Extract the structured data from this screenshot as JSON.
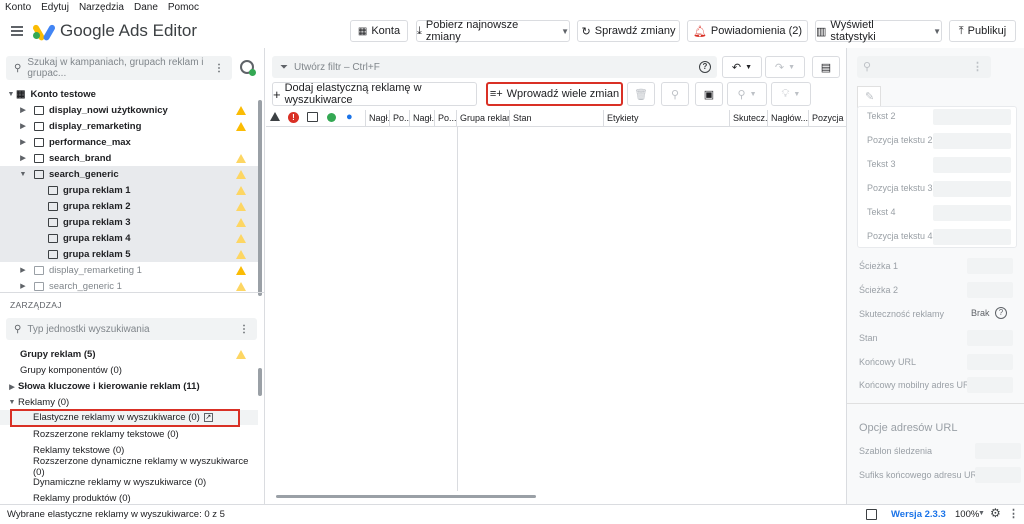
{
  "menu": [
    "Konto",
    "Edytuj",
    "Narzędzia",
    "Dane",
    "Pomoc"
  ],
  "app": {
    "name": "Google Ads Editor"
  },
  "header_buttons": {
    "accounts": "Konta",
    "get_changes": "Pobierz najnowsze zmiany",
    "check_changes": "Sprawdź zmiany",
    "notifications": "Powiadomienia (2)",
    "stats": "Wyświetl statystyki",
    "publish": "Publikuj"
  },
  "left": {
    "search_placeholder": "Szukaj w kampaniach, grupach reklam i grupac...",
    "tree": [
      {
        "label": "Konto testowe",
        "warn": ""
      },
      {
        "label": "display_nowi użytkownicy",
        "warn": "solid"
      },
      {
        "label": "display_remarketing",
        "warn": "solid"
      },
      {
        "label": "performance_max",
        "warn": ""
      },
      {
        "label": "search_brand",
        "warn": "outline"
      },
      {
        "label": "search_generic",
        "warn": "outline"
      },
      {
        "label": "grupa reklam 1",
        "warn": "outline"
      },
      {
        "label": "grupa reklam 2",
        "warn": "outline"
      },
      {
        "label": "grupa reklam 3",
        "warn": "outline"
      },
      {
        "label": "grupa reklam 4",
        "warn": "outline"
      },
      {
        "label": "grupa reklam 5",
        "warn": "outline"
      },
      {
        "label": "display_remarketing 1",
        "warn": "solid"
      },
      {
        "label": "search_generic 1",
        "warn": "outline"
      }
    ],
    "manage_label": "ZARZĄDZAJ",
    "manage_search_placeholder": "Typ jednostki wyszukiwania",
    "manage_items": [
      {
        "label": "Grupy reklam (5)",
        "warn": "outline"
      },
      {
        "label": "Grupy komponentów (0)",
        "warn": ""
      },
      {
        "label": "Słowa kluczowe i kierowanie reklam (11)",
        "warn": ""
      },
      {
        "label": "Reklamy (0)",
        "warn": ""
      },
      {
        "label": "Elastyczne reklamy w wyszukiwarce (0)",
        "warn": ""
      },
      {
        "label": "Rozszerzone reklamy tekstowe (0)",
        "warn": ""
      },
      {
        "label": "Reklamy tekstowe (0)",
        "warn": ""
      },
      {
        "label": "Rozszerzone dynamiczne reklamy w wyszukiwarce (0)",
        "warn": ""
      },
      {
        "label": "Dynamiczne reklamy w wyszukiwarce (0)",
        "warn": ""
      },
      {
        "label": "Reklamy produktów (0)",
        "warn": ""
      }
    ]
  },
  "middle": {
    "filter_placeholder": "Utwórz filtr – Ctrl+F",
    "add_button": "Dodaj elastyczną reklamę w wyszukiwarce",
    "multi_button": "Wprowadź wiele zmian",
    "columns": [
      "Nagł...",
      "Po...",
      "Nagł...",
      "Po...",
      "Grupa reklam",
      "Stan",
      "Etykiety",
      "Skutecz...",
      "Nagłów...",
      "Pozycja ..."
    ]
  },
  "right": {
    "fields": [
      "Tekst 2",
      "Pozycja tekstu 2",
      "Tekst 3",
      "Pozycja tekstu 3",
      "Tekst 4",
      "Pozycja tekstu 4"
    ],
    "path1": "Ścieżka 1",
    "path2": "Ścieżka 2",
    "effectiveness": "Skuteczność reklamy",
    "effectiveness_value": "Brak",
    "status": "Stan",
    "final_url": "Końcowy URL",
    "final_mobile_url": "Końcowy mobilny adres URL",
    "url_options": "Opcje adresów URL",
    "tracking_template": "Szablon śledzenia",
    "final_url_suffix": "Sufiks końcowego adresu URL"
  },
  "status": {
    "selection": "Wybrane elastyczne reklamy w wyszukiwarce: 0 z 5",
    "version": "Wersja 2.3.3",
    "zoom": "100%"
  },
  "colors": {
    "accent": "#1a73e8",
    "warning": "#fbbc04",
    "highlight": "#d93025"
  }
}
